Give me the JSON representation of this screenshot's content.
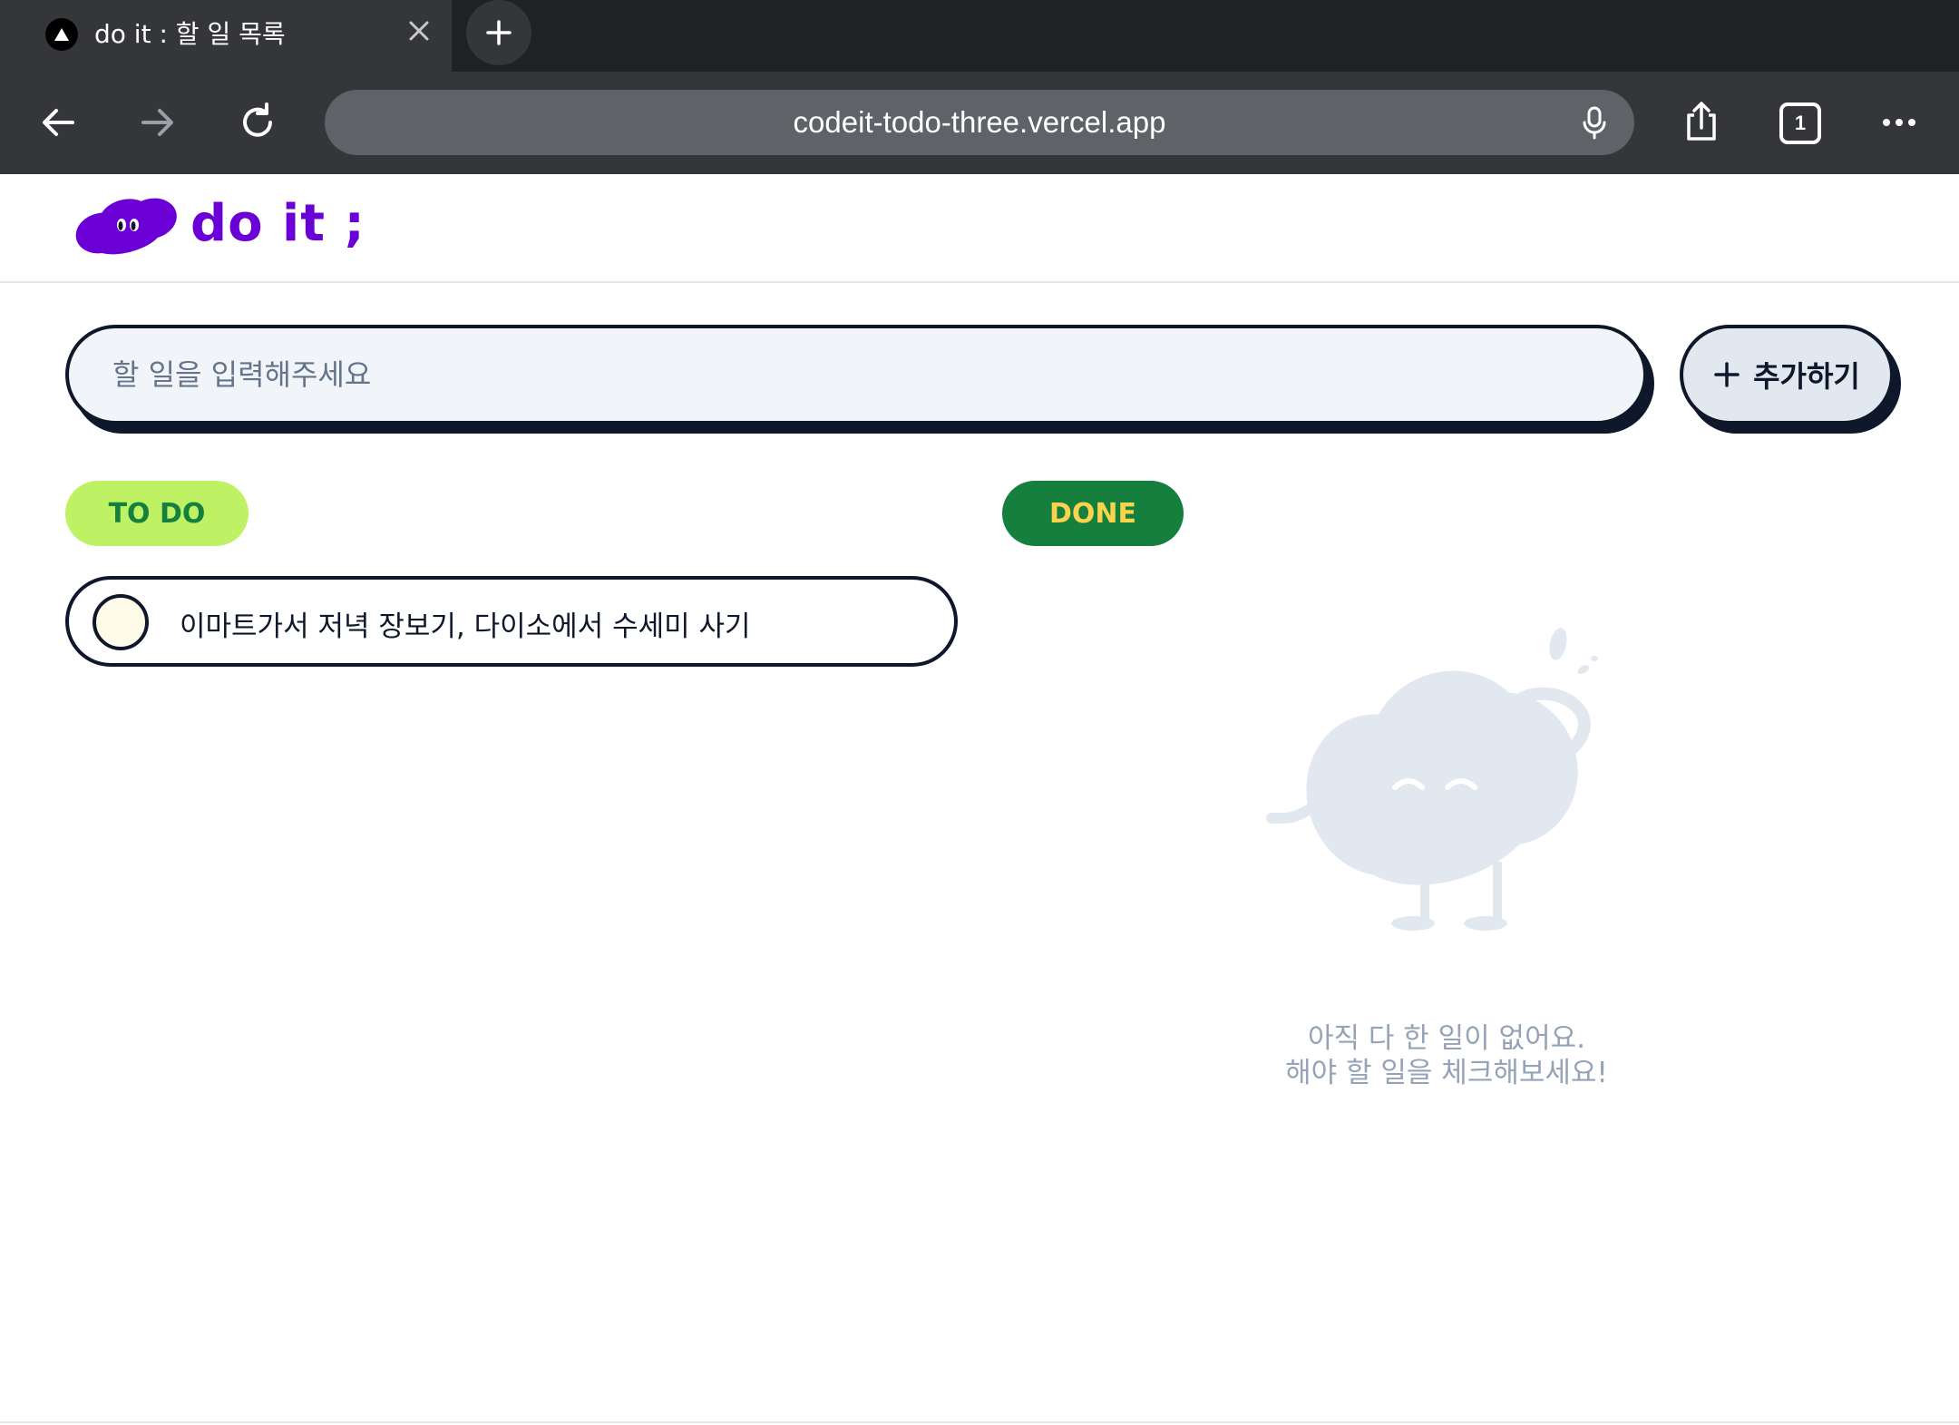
{
  "browser": {
    "tab_title": "do it : 할 일 목록",
    "url": "codeit-todo-three.vercel.app",
    "tab_count": "1"
  },
  "app": {
    "logo_text": "do it ;",
    "search": {
      "placeholder": "할 일을 입력해주세요",
      "value": ""
    },
    "add_button_label": "추가하기",
    "sections": {
      "todo_label": "TO DO",
      "done_label": "DONE"
    },
    "todos": [
      {
        "text": "이마트가서 저녁 장보기, 다이소에서 수세미 사기",
        "done": false
      }
    ],
    "done_empty": {
      "line1": "아직 다 한 일이 없어요.",
      "line2": "해야 할 일을 체크해보세요!"
    }
  },
  "colors": {
    "brand_purple": "#6b00d6",
    "todo_badge_bg": "#bef264",
    "done_badge_bg": "#15803d",
    "done_badge_text": "#fcd34d",
    "ink": "#0f172a"
  },
  "icons": [
    "back-arrow-icon",
    "forward-arrow-icon",
    "reload-icon",
    "mic-icon",
    "share-icon",
    "more-icon",
    "close-icon",
    "plus-icon"
  ]
}
